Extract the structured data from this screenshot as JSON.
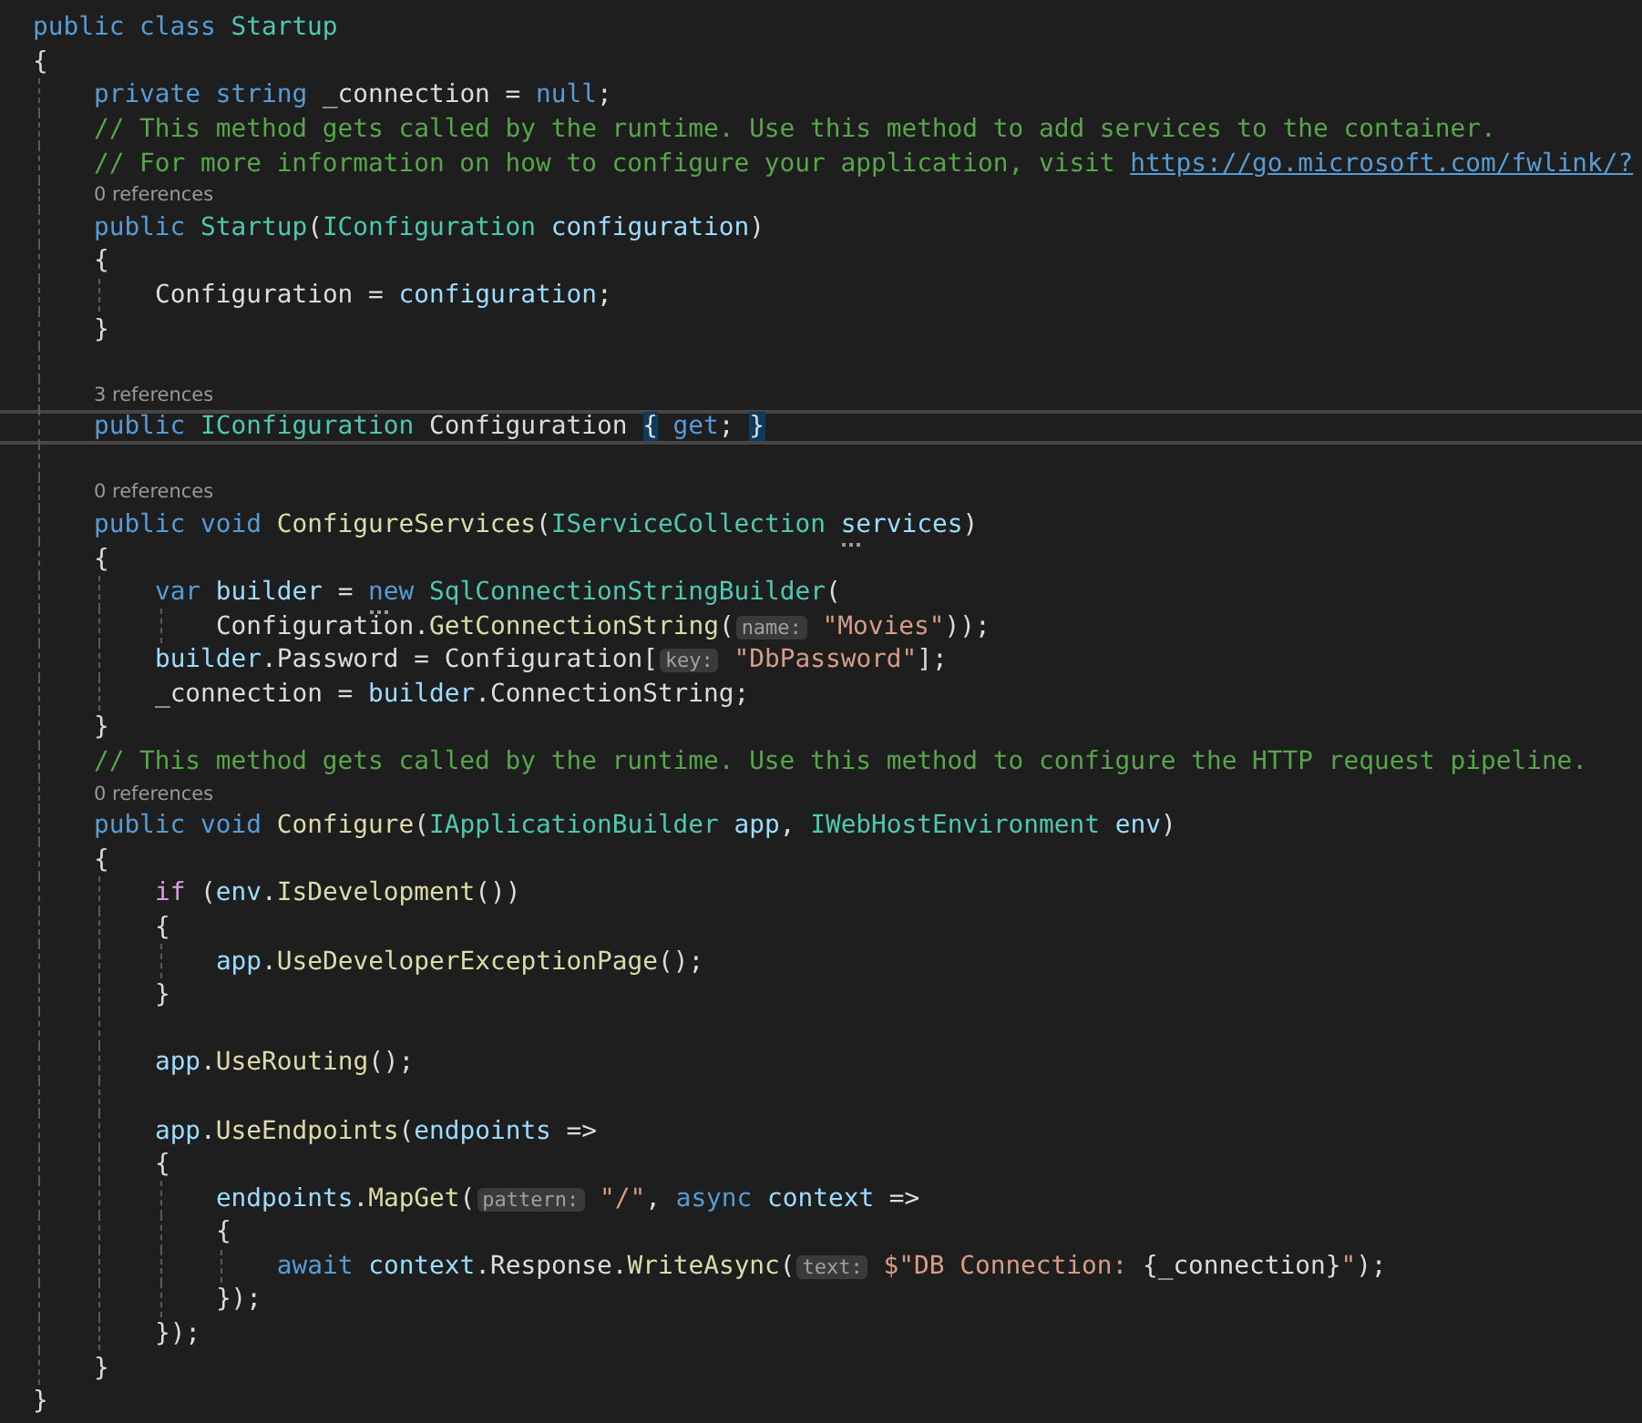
{
  "lines": [
    {
      "kind": "code",
      "tokens": [
        {
          "kind": "keyword",
          "text": "public"
        },
        {
          "kind": "keyword",
          "text": " class"
        },
        {
          "kind": "type",
          "text": " Startup"
        }
      ]
    },
    {
      "kind": "code",
      "tokens": [
        {
          "kind": "plain",
          "text": "{"
        }
      ],
      "children": [
        {
          "kind": "code",
          "tokens": [
            {
              "kind": "keyword",
              "text": "private"
            },
            {
              "kind": "keyword",
              "text": " string"
            },
            {
              "kind": "plain",
              "text": " _connection = "
            },
            {
              "kind": "keyword",
              "text": "null"
            },
            {
              "kind": "plain",
              "text": ";"
            }
          ]
        },
        {
          "kind": "code",
          "tokens": [
            {
              "kind": "comment",
              "text": "// This method gets called by the runtime. Use this method to add services to the container."
            }
          ]
        },
        {
          "kind": "code",
          "tokens": [
            {
              "kind": "comment",
              "text": "// For more information on how to configure your application, visit "
            },
            {
              "kind": "link",
              "text": "https://go.microsoft.com/fwlink/?"
            }
          ]
        },
        {
          "kind": "codelens",
          "tokens": [
            {
              "kind": "lens",
              "text": "0 references"
            }
          ]
        },
        {
          "kind": "code",
          "tokens": [
            {
              "kind": "keyword",
              "text": "public"
            },
            {
              "kind": "type",
              "text": " Startup"
            },
            {
              "kind": "plain",
              "text": "("
            },
            {
              "kind": "type",
              "text": "IConfiguration"
            },
            {
              "kind": "variable",
              "text": " configuration"
            },
            {
              "kind": "plain",
              "text": ")"
            }
          ]
        },
        {
          "kind": "code",
          "tokens": [
            {
              "kind": "plain",
              "text": "{"
            }
          ],
          "children": [
            {
              "kind": "code",
              "tokens": [
                {
                  "kind": "plain",
                  "text": "Configuration = "
                },
                {
                  "kind": "variable",
                  "text": "configuration"
                },
                {
                  "kind": "plain",
                  "text": ";"
                }
              ]
            }
          ]
        },
        {
          "kind": "code",
          "tokens": [
            {
              "kind": "plain",
              "text": "}"
            }
          ]
        },
        {
          "kind": "blank"
        },
        {
          "kind": "codelens",
          "tokens": [
            {
              "kind": "lens",
              "text": "3 references"
            }
          ]
        },
        {
          "kind": "code",
          "current": true,
          "tokens": [
            {
              "kind": "keyword",
              "text": "public"
            },
            {
              "kind": "type",
              "text": " IConfiguration"
            },
            {
              "kind": "plain",
              "text": " Configuration "
            },
            {
              "kind": "plain",
              "text": "{",
              "matched": true
            },
            {
              "kind": "keyword",
              "text": " get"
            },
            {
              "kind": "plain",
              "text": "; "
            },
            {
              "kind": "plain",
              "text": "}",
              "matched": true
            }
          ]
        },
        {
          "kind": "blank"
        },
        {
          "kind": "codelens",
          "tokens": [
            {
              "kind": "lens",
              "text": "0 references"
            }
          ]
        },
        {
          "kind": "code",
          "tokens": [
            {
              "kind": "keyword",
              "text": "public"
            },
            {
              "kind": "keyword",
              "text": " void"
            },
            {
              "kind": "method",
              "text": " ConfigureServices"
            },
            {
              "kind": "plain",
              "text": "("
            },
            {
              "kind": "type",
              "text": "IServiceCollection "
            },
            {
              "kind": "variable",
              "text": "services",
              "suggestion": true
            },
            {
              "kind": "plain",
              "text": ")"
            }
          ]
        },
        {
          "kind": "code",
          "tokens": [
            {
              "kind": "plain",
              "text": "{"
            }
          ],
          "children": [
            {
              "kind": "code",
              "tokens": [
                {
                  "kind": "keyword",
                  "text": "var"
                },
                {
                  "kind": "variable",
                  "text": " builder"
                },
                {
                  "kind": "plain",
                  "text": " = "
                },
                {
                  "kind": "keyword",
                  "text": "new",
                  "suggestion": true
                },
                {
                  "kind": "type",
                  "text": " SqlConnectionStringBuilder"
                },
                {
                  "kind": "plain",
                  "text": "("
                }
              ],
              "children": [
                {
                  "kind": "code",
                  "tokens": [
                    {
                      "kind": "plain",
                      "text": "Configuration."
                    },
                    {
                      "kind": "method",
                      "text": "GetConnectionString"
                    },
                    {
                      "kind": "plain",
                      "text": "("
                    },
                    {
                      "kind": "hint",
                      "text": "name:"
                    },
                    {
                      "kind": "string",
                      "text": " \"Movies\""
                    },
                    {
                      "kind": "plain",
                      "text": "));"
                    }
                  ]
                }
              ]
            },
            {
              "kind": "code",
              "tokens": [
                {
                  "kind": "variable",
                  "text": "builder"
                },
                {
                  "kind": "plain",
                  "text": ".Password = Configuration["
                },
                {
                  "kind": "hint",
                  "text": "key:"
                },
                {
                  "kind": "string",
                  "text": " \"DbPassword\""
                },
                {
                  "kind": "plain",
                  "text": "];"
                }
              ]
            },
            {
              "kind": "code",
              "tokens": [
                {
                  "kind": "plain",
                  "text": "_connection = "
                },
                {
                  "kind": "variable",
                  "text": "builder"
                },
                {
                  "kind": "plain",
                  "text": ".ConnectionString;"
                }
              ]
            }
          ]
        },
        {
          "kind": "code",
          "tokens": [
            {
              "kind": "plain",
              "text": "}"
            }
          ]
        },
        {
          "kind": "code",
          "tokens": [
            {
              "kind": "comment",
              "text": "// This method gets called by the runtime. Use this method to configure the HTTP request pipeline."
            }
          ]
        },
        {
          "kind": "codelens",
          "tokens": [
            {
              "kind": "lens",
              "text": "0 references"
            }
          ]
        },
        {
          "kind": "code",
          "tokens": [
            {
              "kind": "keyword",
              "text": "public"
            },
            {
              "kind": "keyword",
              "text": " void"
            },
            {
              "kind": "method",
              "text": " Configure"
            },
            {
              "kind": "plain",
              "text": "("
            },
            {
              "kind": "type",
              "text": "IApplicationBuilder"
            },
            {
              "kind": "variable",
              "text": " app"
            },
            {
              "kind": "plain",
              "text": ", "
            },
            {
              "kind": "type",
              "text": "IWebHostEnvironment"
            },
            {
              "kind": "variable",
              "text": " env"
            },
            {
              "kind": "plain",
              "text": ")"
            }
          ]
        },
        {
          "kind": "code",
          "tokens": [
            {
              "kind": "plain",
              "text": "{"
            }
          ],
          "children": [
            {
              "kind": "code",
              "tokens": [
                {
                  "kind": "control",
                  "text": "if"
                },
                {
                  "kind": "plain",
                  "text": " ("
                },
                {
                  "kind": "variable",
                  "text": "env"
                },
                {
                  "kind": "plain",
                  "text": "."
                },
                {
                  "kind": "method",
                  "text": "IsDevelopment"
                },
                {
                  "kind": "plain",
                  "text": "())"
                }
              ]
            },
            {
              "kind": "code",
              "tokens": [
                {
                  "kind": "plain",
                  "text": "{"
                }
              ],
              "children": [
                {
                  "kind": "code",
                  "tokens": [
                    {
                      "kind": "variable",
                      "text": "app"
                    },
                    {
                      "kind": "plain",
                      "text": "."
                    },
                    {
                      "kind": "method",
                      "text": "UseDeveloperExceptionPage"
                    },
                    {
                      "kind": "plain",
                      "text": "();"
                    }
                  ]
                }
              ]
            },
            {
              "kind": "code",
              "tokens": [
                {
                  "kind": "plain",
                  "text": "}"
                }
              ]
            },
            {
              "kind": "blank"
            },
            {
              "kind": "code",
              "tokens": [
                {
                  "kind": "variable",
                  "text": "app"
                },
                {
                  "kind": "plain",
                  "text": "."
                },
                {
                  "kind": "method",
                  "text": "UseRouting"
                },
                {
                  "kind": "plain",
                  "text": "();"
                }
              ]
            },
            {
              "kind": "blank"
            },
            {
              "kind": "code",
              "tokens": [
                {
                  "kind": "variable",
                  "text": "app"
                },
                {
                  "kind": "plain",
                  "text": "."
                },
                {
                  "kind": "method",
                  "text": "UseEndpoints"
                },
                {
                  "kind": "plain",
                  "text": "("
                },
                {
                  "kind": "variable",
                  "text": "endpoints"
                },
                {
                  "kind": "plain",
                  "text": " =>"
                }
              ]
            },
            {
              "kind": "code",
              "tokens": [
                {
                  "kind": "plain",
                  "text": "{"
                }
              ],
              "children": [
                {
                  "kind": "code",
                  "tokens": [
                    {
                      "kind": "variable",
                      "text": "endpoints"
                    },
                    {
                      "kind": "plain",
                      "text": "."
                    },
                    {
                      "kind": "method",
                      "text": "MapGet"
                    },
                    {
                      "kind": "plain",
                      "text": "("
                    },
                    {
                      "kind": "hint",
                      "text": "pattern:"
                    },
                    {
                      "kind": "string",
                      "text": " \"/\""
                    },
                    {
                      "kind": "plain",
                      "text": ", "
                    },
                    {
                      "kind": "keyword",
                      "text": "async"
                    },
                    {
                      "kind": "variable",
                      "text": " context"
                    },
                    {
                      "kind": "plain",
                      "text": " =>"
                    }
                  ]
                },
                {
                  "kind": "code",
                  "tokens": [
                    {
                      "kind": "plain",
                      "text": "{"
                    }
                  ],
                  "children": [
                    {
                      "kind": "code",
                      "tokens": [
                        {
                          "kind": "keyword",
                          "text": "await"
                        },
                        {
                          "kind": "variable",
                          "text": " context"
                        },
                        {
                          "kind": "plain",
                          "text": ".Response."
                        },
                        {
                          "kind": "method",
                          "text": "WriteAsync"
                        },
                        {
                          "kind": "plain",
                          "text": "("
                        },
                        {
                          "kind": "hint",
                          "text": "text:"
                        },
                        {
                          "kind": "string",
                          "text": " $\"DB Connection: "
                        },
                        {
                          "kind": "plain",
                          "text": "{_connection}"
                        },
                        {
                          "kind": "string",
                          "text": "\""
                        },
                        {
                          "kind": "plain",
                          "text": ");"
                        }
                      ]
                    }
                  ]
                },
                {
                  "kind": "code",
                  "tokens": [
                    {
                      "kind": "plain",
                      "text": "});"
                    }
                  ]
                }
              ]
            },
            {
              "kind": "code",
              "tokens": [
                {
                  "kind": "plain",
                  "text": "});"
                }
              ]
            }
          ]
        },
        {
          "kind": "code",
          "tokens": [
            {
              "kind": "plain",
              "text": "}"
            }
          ]
        }
      ]
    },
    {
      "kind": "code",
      "tokens": [
        {
          "kind": "plain",
          "text": "}"
        }
      ]
    }
  ]
}
